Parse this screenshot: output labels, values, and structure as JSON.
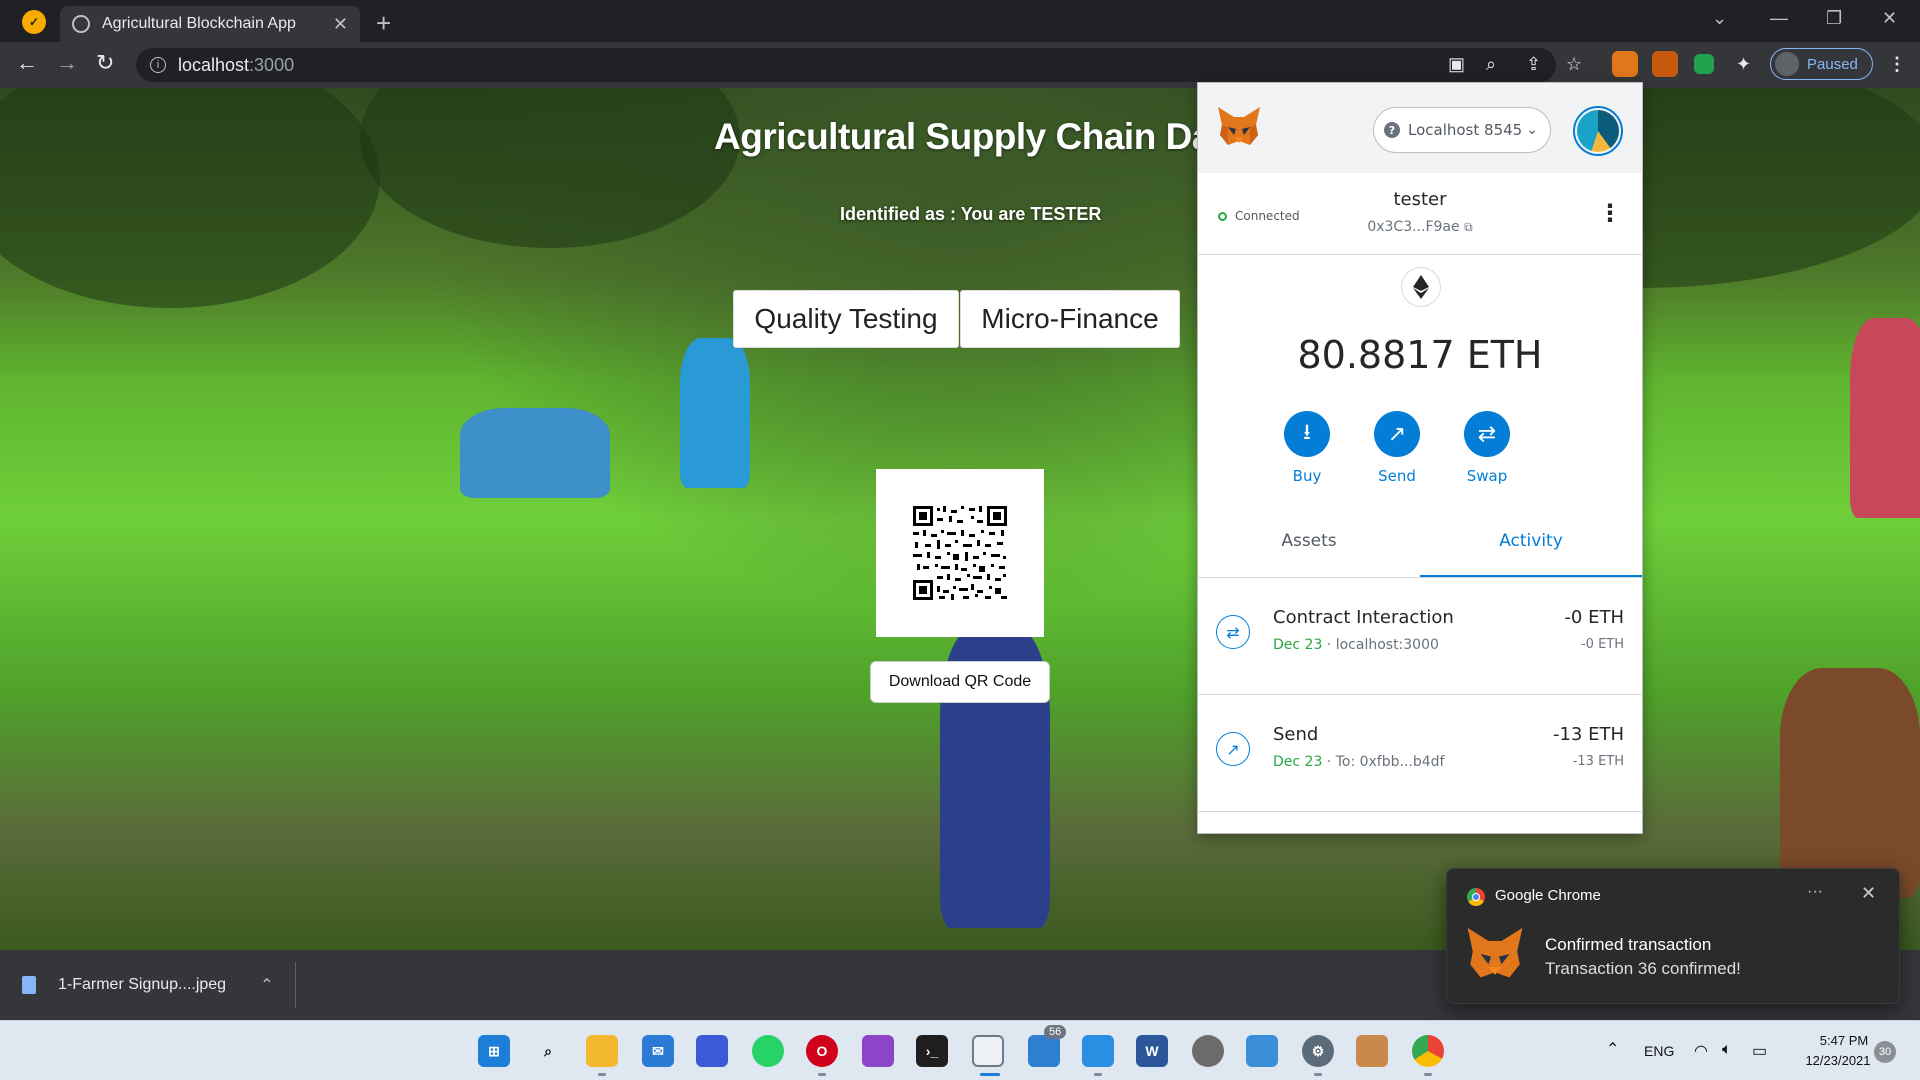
{
  "browser": {
    "tab_title": "Agricultural Blockchain App",
    "url_host": "localhost",
    "url_port": ":3000",
    "profile_label": "Paused"
  },
  "page": {
    "title": "Agricultural Supply Chain Dapp",
    "identity": "Identified as : You are TESTER",
    "tabs": [
      {
        "label": "Quality Testing"
      },
      {
        "label": "Micro-Finance"
      }
    ],
    "download_qr_label": "Download QR Code"
  },
  "metamask": {
    "network": "Localhost 8545",
    "connected_label": "Connected",
    "account_name": "tester",
    "account_address": "0x3C3...F9ae",
    "balance": "80.8817 ETH",
    "actions": [
      {
        "label": "Buy"
      },
      {
        "label": "Send"
      },
      {
        "label": "Swap"
      }
    ],
    "tabs": [
      {
        "label": "Assets"
      },
      {
        "label": "Activity"
      }
    ],
    "transactions": [
      {
        "title": "Contract Interaction",
        "date": "Dec 23",
        "detail": " · localhost:3000",
        "amount": "-0 ETH",
        "amount_secondary": "-0 ETH"
      },
      {
        "title": "Send",
        "date": "Dec 23",
        "detail": " · To: 0xfbb...b4df",
        "amount": "-13 ETH",
        "amount_secondary": "-13 ETH"
      }
    ]
  },
  "downloads": {
    "file_name": "1-Farmer Signup....jpeg"
  },
  "notification": {
    "app": "Google Chrome",
    "more": "···",
    "title": "Confirmed transaction",
    "body": "Transaction 36 confirmed!"
  },
  "taskbar": {
    "badge_count": "56",
    "language": "ENG",
    "time": "5:47 PM",
    "date": "12/23/2021",
    "notification_count": "30"
  }
}
